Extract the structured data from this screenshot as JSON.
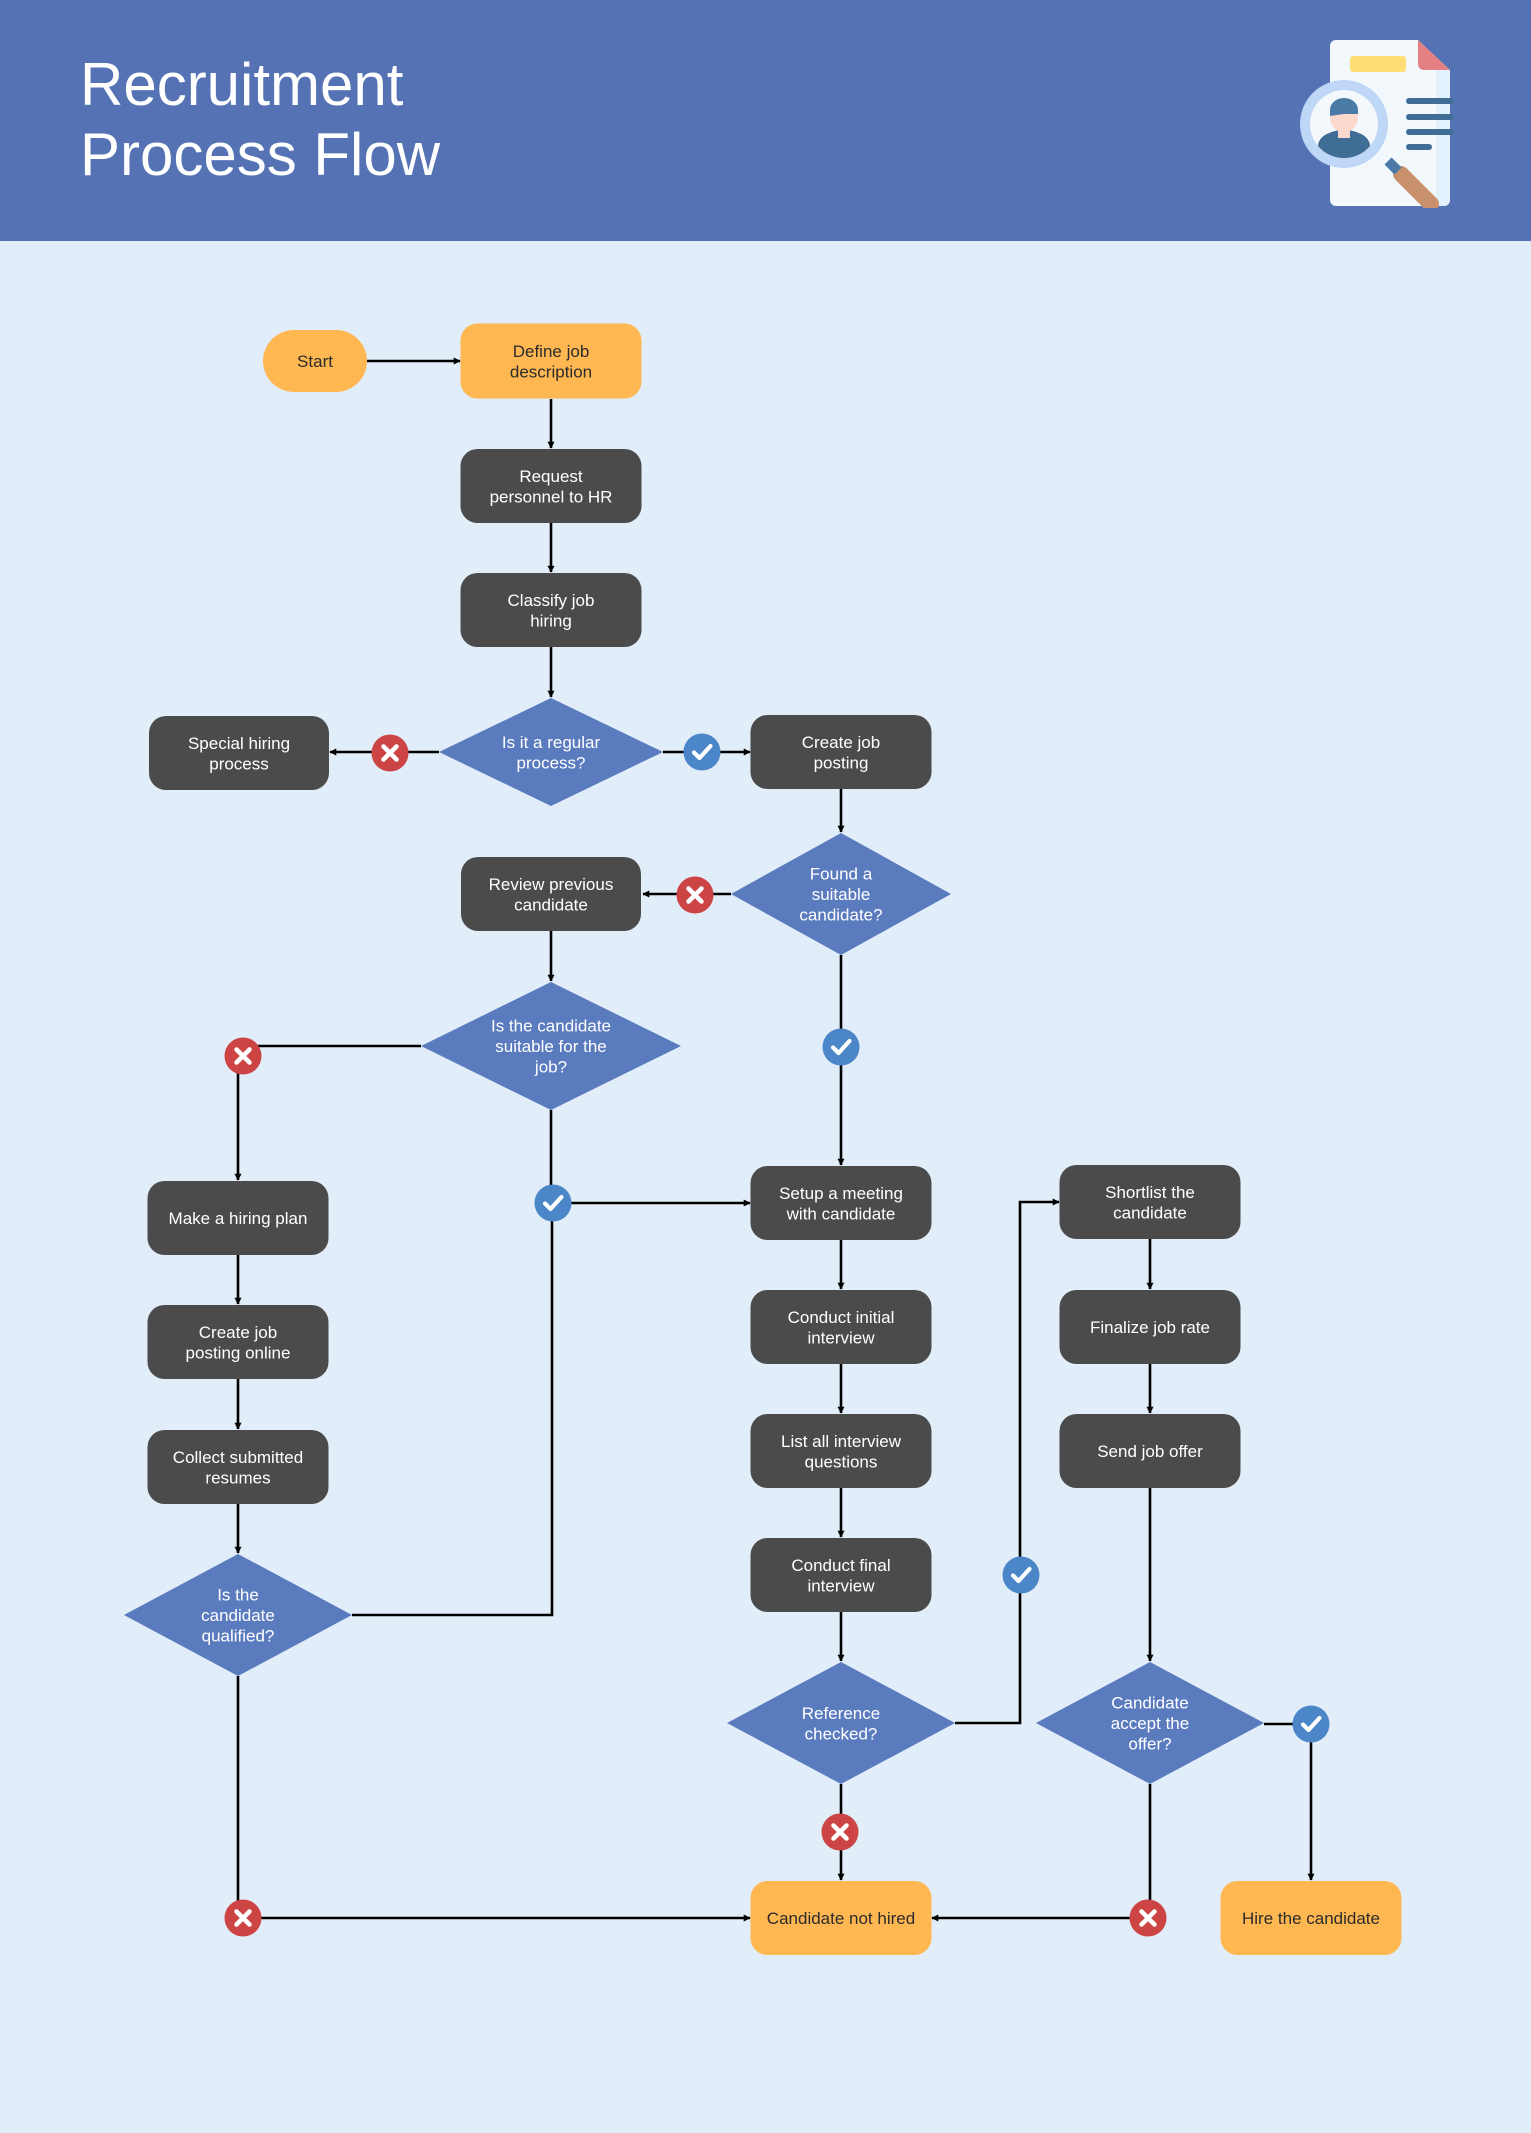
{
  "header": {
    "title_line1": "Recruitment",
    "title_line2": "Process Flow",
    "icon": "resume-search-icon"
  },
  "colors": {
    "header_bg": "#5573b4",
    "canvas_bg": "#e1edf9",
    "terminal_fill": "#ffb752",
    "process_fill": "#4b4b4b",
    "decision_fill": "#5b7bbf",
    "yes_badge": "#4a86c8",
    "no_badge": "#cc4444",
    "connector": "#000000"
  },
  "nodes": {
    "start": {
      "label": [
        "Start"
      ],
      "type": "terminal"
    },
    "define_job": {
      "label": [
        "Define job",
        "description"
      ],
      "type": "terminal"
    },
    "request_hr": {
      "label": [
        "Request",
        "personnel to HR"
      ],
      "type": "process"
    },
    "classify": {
      "label": [
        "Classify job",
        "hiring"
      ],
      "type": "process"
    },
    "regular_q": {
      "label": [
        "Is it a regular",
        "process?"
      ],
      "type": "decision"
    },
    "special": {
      "label": [
        "Special hiring",
        "process"
      ],
      "type": "process"
    },
    "create_posting": {
      "label": [
        "Create job",
        "posting"
      ],
      "type": "process"
    },
    "found_q": {
      "label": [
        "Found a",
        "suitable",
        "candidate?"
      ],
      "type": "decision"
    },
    "review_prev": {
      "label": [
        "Review previous",
        "candidate"
      ],
      "type": "process"
    },
    "suitable_q": {
      "label": [
        "Is the candidate",
        "suitable for the",
        "job?"
      ],
      "type": "decision"
    },
    "hiring_plan": {
      "label": [
        "Make a hiring plan"
      ],
      "type": "process"
    },
    "posting_online": {
      "label": [
        "Create job",
        "posting online"
      ],
      "type": "process"
    },
    "collect": {
      "label": [
        "Collect submitted",
        "resumes"
      ],
      "type": "process"
    },
    "qualified_q": {
      "label": [
        "Is the",
        "candidate",
        "qualified?"
      ],
      "type": "decision"
    },
    "setup_meeting": {
      "label": [
        "Setup a meeting",
        "with candidate"
      ],
      "type": "process"
    },
    "initial_interview": {
      "label": [
        "Conduct initial",
        "interview"
      ],
      "type": "process"
    },
    "list_questions": {
      "label": [
        "List all interview",
        "questions"
      ],
      "type": "process"
    },
    "final_interview": {
      "label": [
        "Conduct final",
        "interview"
      ],
      "type": "process"
    },
    "reference_q": {
      "label": [
        "Reference",
        "checked?"
      ],
      "type": "decision"
    },
    "shortlist": {
      "label": [
        "Shortlist the",
        "candidate"
      ],
      "type": "process"
    },
    "finalize_rate": {
      "label": [
        "Finalize job rate"
      ],
      "type": "process"
    },
    "send_offer": {
      "label": [
        "Send job offer"
      ],
      "type": "process"
    },
    "accept_q": {
      "label": [
        "Candidate",
        "accept the",
        "offer?"
      ],
      "type": "decision"
    },
    "not_hired": {
      "label": [
        "Candidate not hired"
      ],
      "type": "terminal"
    },
    "hire": {
      "label": [
        "Hire the candidate"
      ],
      "type": "terminal"
    }
  },
  "edges": [
    {
      "from": "start",
      "to": "define_job",
      "badge": null
    },
    {
      "from": "define_job",
      "to": "request_hr",
      "badge": null
    },
    {
      "from": "request_hr",
      "to": "classify",
      "badge": null
    },
    {
      "from": "classify",
      "to": "regular_q",
      "badge": null
    },
    {
      "from": "regular_q",
      "to": "special",
      "badge": "no"
    },
    {
      "from": "regular_q",
      "to": "create_posting",
      "badge": "yes"
    },
    {
      "from": "create_posting",
      "to": "found_q",
      "badge": null
    },
    {
      "from": "found_q",
      "to": "review_prev",
      "badge": "no"
    },
    {
      "from": "found_q",
      "to": "setup_meeting",
      "badge": "yes"
    },
    {
      "from": "review_prev",
      "to": "suitable_q",
      "badge": null
    },
    {
      "from": "suitable_q",
      "to": "hiring_plan",
      "badge": "no"
    },
    {
      "from": "suitable_q",
      "to": "setup_meeting",
      "badge": "yes"
    },
    {
      "from": "hiring_plan",
      "to": "posting_online",
      "badge": null
    },
    {
      "from": "posting_online",
      "to": "collect",
      "badge": null
    },
    {
      "from": "collect",
      "to": "qualified_q",
      "badge": null
    },
    {
      "from": "qualified_q",
      "to": "setup_meeting",
      "badge": "yes"
    },
    {
      "from": "qualified_q",
      "to": "not_hired",
      "badge": "no"
    },
    {
      "from": "setup_meeting",
      "to": "initial_interview",
      "badge": null
    },
    {
      "from": "initial_interview",
      "to": "list_questions",
      "badge": null
    },
    {
      "from": "list_questions",
      "to": "final_interview",
      "badge": null
    },
    {
      "from": "final_interview",
      "to": "reference_q",
      "badge": null
    },
    {
      "from": "reference_q",
      "to": "shortlist",
      "badge": "yes"
    },
    {
      "from": "reference_q",
      "to": "not_hired",
      "badge": "no"
    },
    {
      "from": "shortlist",
      "to": "finalize_rate",
      "badge": null
    },
    {
      "from": "finalize_rate",
      "to": "send_offer",
      "badge": null
    },
    {
      "from": "send_offer",
      "to": "accept_q",
      "badge": null
    },
    {
      "from": "accept_q",
      "to": "hire",
      "badge": "yes"
    },
    {
      "from": "accept_q",
      "to": "not_hired",
      "badge": "no"
    }
  ]
}
